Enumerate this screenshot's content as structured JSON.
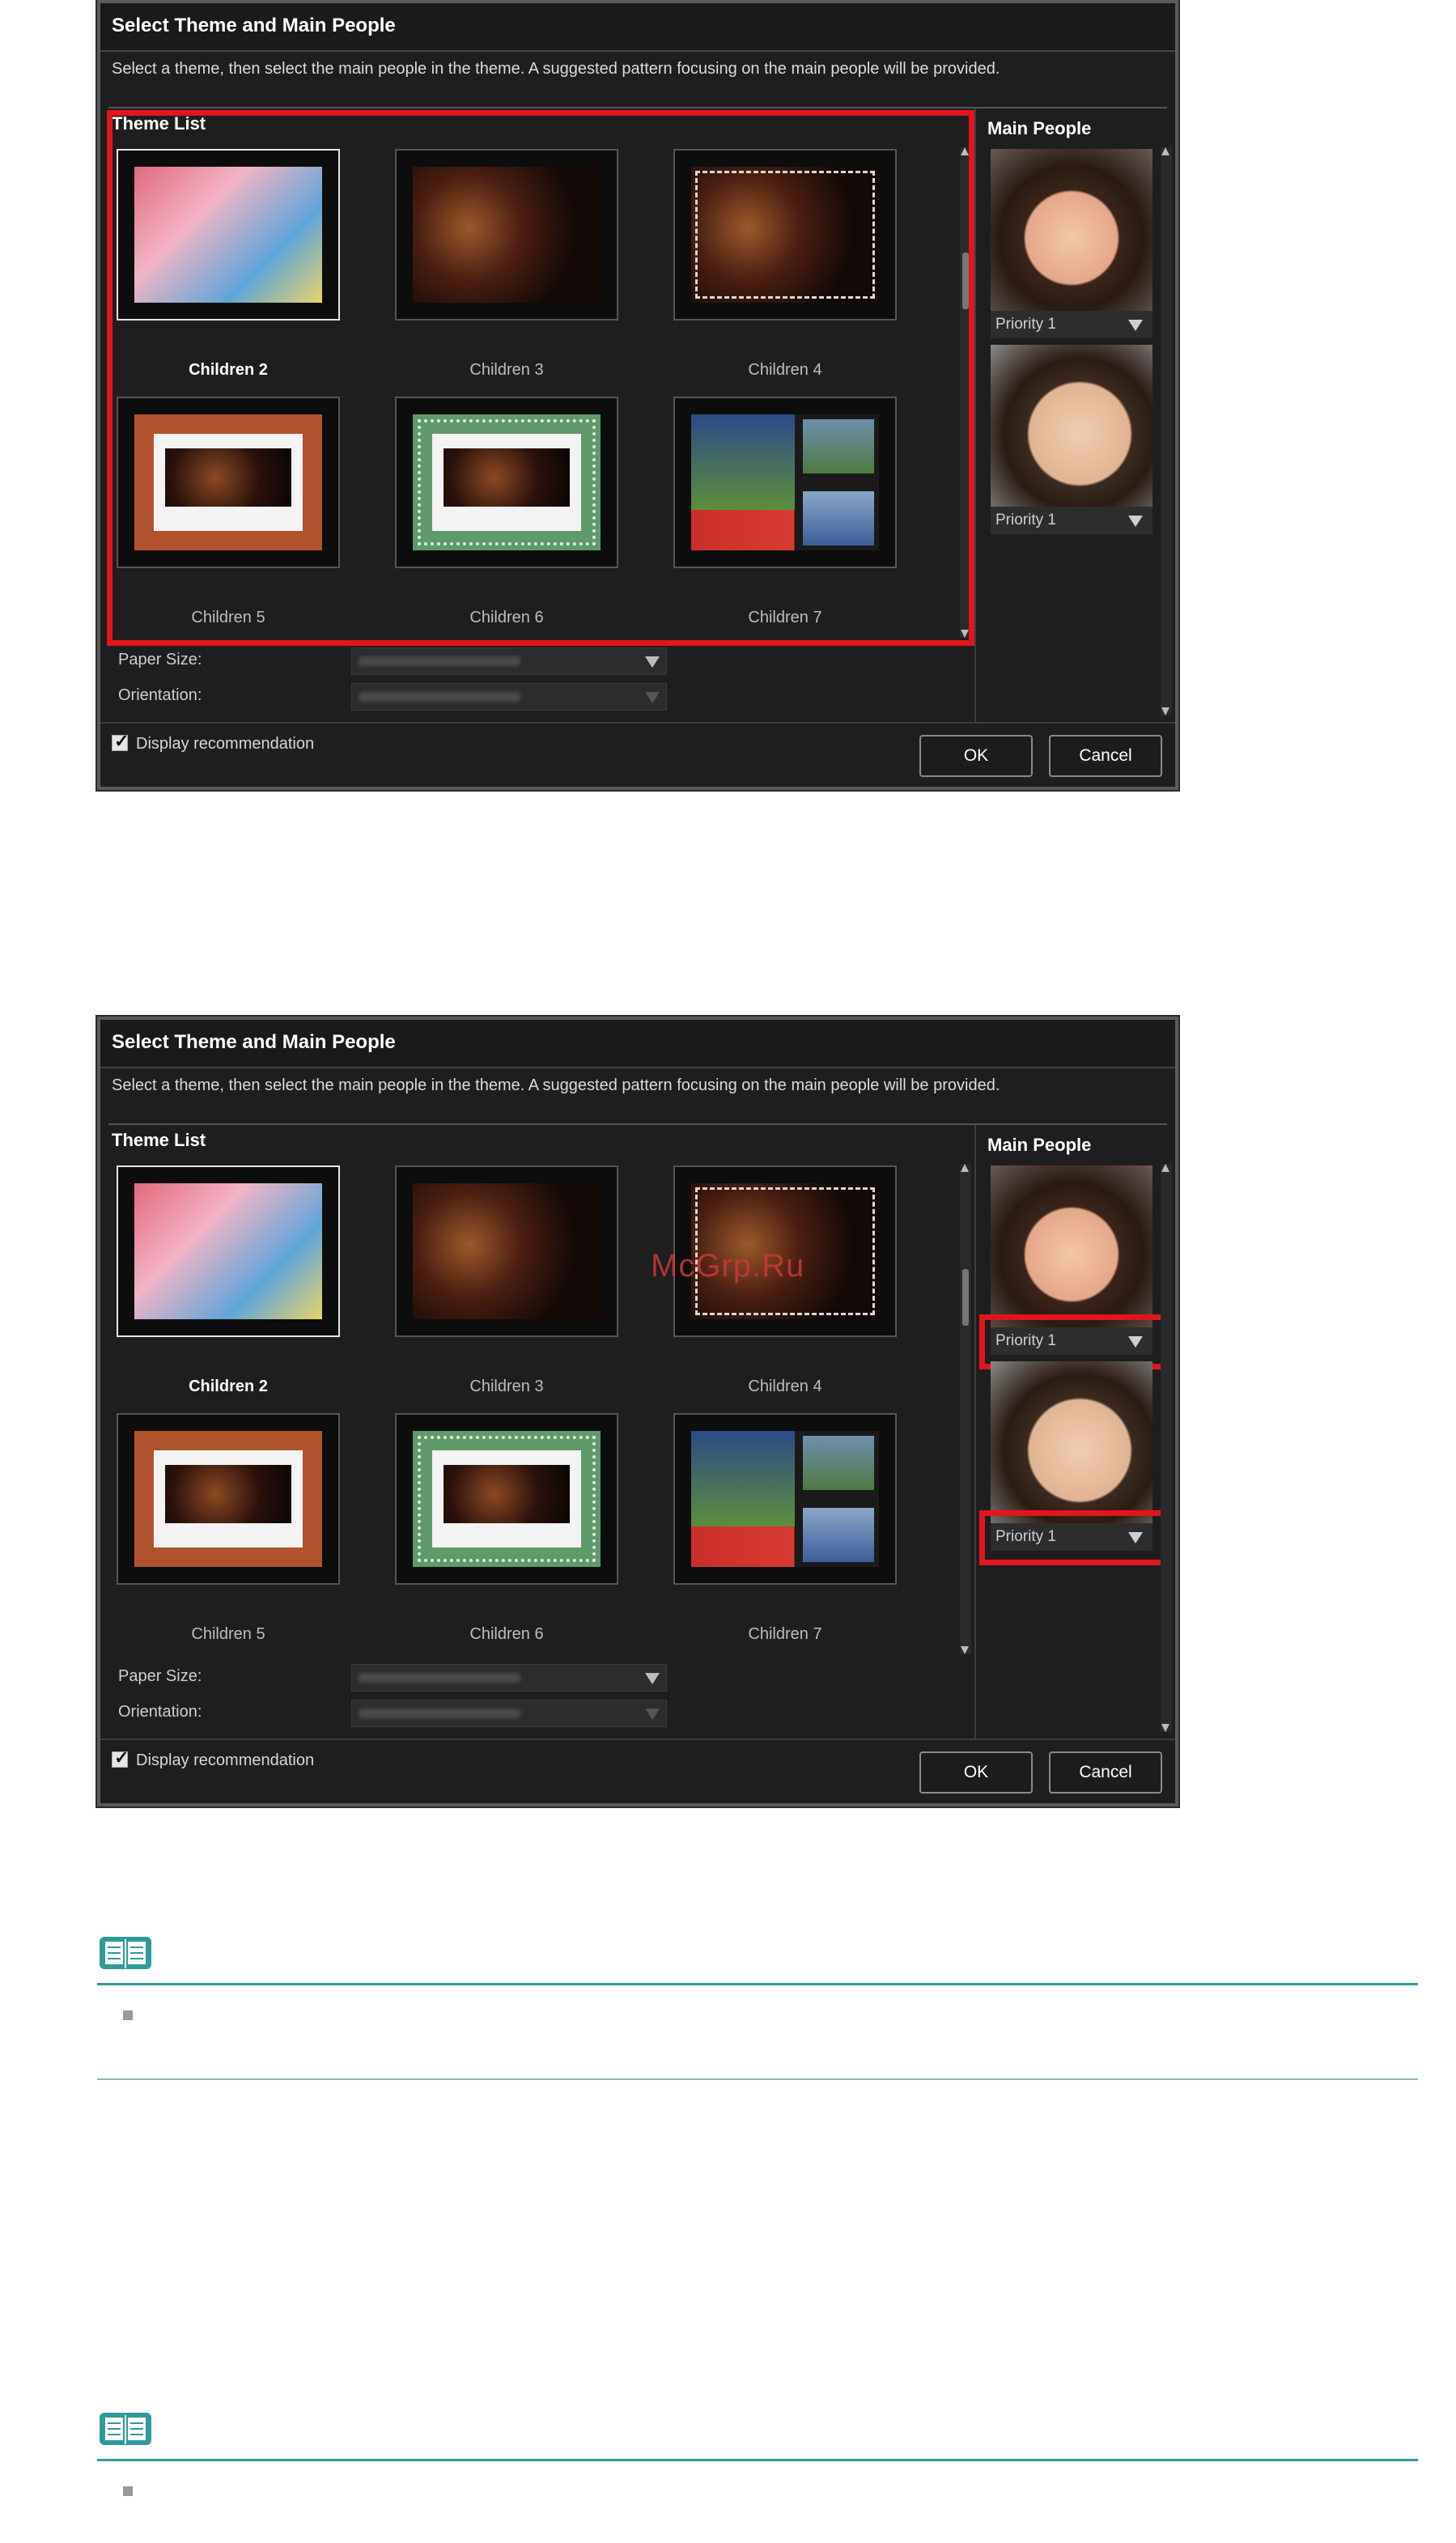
{
  "dialog": {
    "title": "Select Theme and Main People",
    "description": "Select a theme, then select the main people in the theme. A suggested pattern focusing on the main people will be provided.",
    "theme_list_label": "Theme List",
    "main_people_label": "Main People",
    "themes": [
      {
        "label": "Children 2",
        "selected": true
      },
      {
        "label": "Children 3",
        "selected": false
      },
      {
        "label": "Children 4",
        "selected": false
      },
      {
        "label": "Children 5",
        "selected": false
      },
      {
        "label": "Children 6",
        "selected": false
      },
      {
        "label": "Children 7",
        "selected": false
      }
    ],
    "paper_size_label": "Paper Size:",
    "orientation_label": "Orientation:",
    "people": [
      {
        "priority": "Priority 1"
      },
      {
        "priority": "Priority 1"
      }
    ],
    "display_recommendation_label": "Display recommendation",
    "display_recommendation_checked": true,
    "ok_label": "OK",
    "cancel_label": "Cancel"
  },
  "watermark": "McGrp.Ru",
  "colors": {
    "highlight_red": "#e0161c",
    "note_rule": "#2f9a9a",
    "dialog_bg": "#1e1e1e"
  },
  "icons": [
    "note-book-icon",
    "bullet-icon",
    "dropdown-arrow-icon",
    "checkbox-icon"
  ]
}
